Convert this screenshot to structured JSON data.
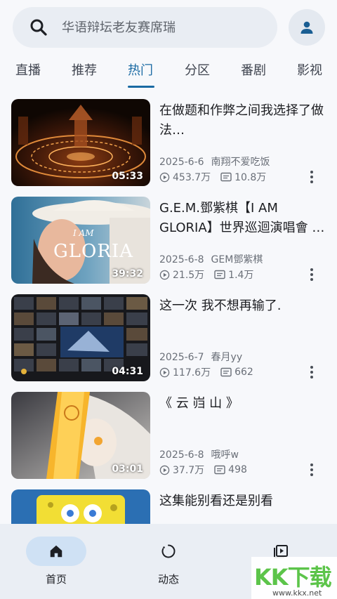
{
  "search": {
    "placeholder": "华语辩坛老友赛席瑞",
    "icon": "search-icon"
  },
  "account": {
    "icon": "person-icon"
  },
  "tabs": [
    {
      "label": "直播",
      "active": false
    },
    {
      "label": "推荐",
      "active": false
    },
    {
      "label": "热门",
      "active": true
    },
    {
      "label": "分区",
      "active": false
    },
    {
      "label": "番剧",
      "active": false
    },
    {
      "label": "影视",
      "active": false
    }
  ],
  "videos": [
    {
      "title": "在做题和作弊之间我选择了做法…",
      "date": "2025-6-6",
      "author": "南翔不爱吃饭",
      "plays": "453.7万",
      "comments": "10.8万",
      "duration": "05:33"
    },
    {
      "title": "G.E.M.鄧紫棋【I AM GLORIA】世界巡迴演唱會 …",
      "date": "2025-6-8",
      "author": "GEM鄧紫棋",
      "plays": "21.5万",
      "comments": "1.4万",
      "duration": "39:32",
      "thumb_text": "I AM GLORIA"
    },
    {
      "title": "这一次  我不想再输了.",
      "date": "2025-6-7",
      "author": "春月yy",
      "plays": "117.6万",
      "comments": "662",
      "duration": "04:31"
    },
    {
      "title": "《 云 岿 山 》",
      "date": "2025-6-8",
      "author": "哦呼w",
      "plays": "37.7万",
      "comments": "498",
      "duration": "03:01"
    },
    {
      "title": "这集能别看还是别看"
    }
  ],
  "bottom_nav": [
    {
      "label": "首页",
      "icon": "home-icon",
      "active": true
    },
    {
      "label": "动态",
      "icon": "refresh-circle-icon",
      "active": false
    },
    {
      "label": "",
      "icon": "play-library-icon",
      "active": false
    }
  ],
  "watermark": {
    "text": "KK下载",
    "url": "www.kkx.net"
  },
  "colors": {
    "accent": "#1a6aa3",
    "background": "#f7f8fb",
    "nav_active_pill": "#cfe1f4"
  }
}
